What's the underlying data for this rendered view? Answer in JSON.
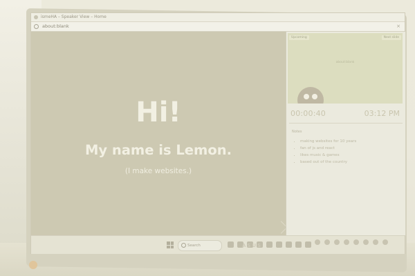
{
  "window": {
    "title": "ismeHA – Speaker View – Home",
    "url": "about:blank",
    "close_glyph": "×"
  },
  "slide": {
    "heading": "Hi!",
    "line": "My name is Lemon.",
    "subline": "(I make websites.)"
  },
  "speaker_view": {
    "preview_label_left": "Upcoming",
    "preview_label_right": "Next slide",
    "preview_center_text": "about:blank",
    "elapsed": "00:00:40",
    "clock": "03:12 PM",
    "notes_title": "Notes",
    "notes": [
      "making websites for 10 years",
      "fan of js and react",
      "likes music & games",
      "based out of the country"
    ]
  },
  "taskbar": {
    "search_placeholder": "Search"
  },
  "laptop": {
    "brand": "ASUS"
  },
  "colors": {
    "slide_bg": "#cdc9b2",
    "slide_text": "#f2f0e3",
    "panel_bg": "#ebeade"
  },
  "icons": [
    "browser-icon",
    "globe-icon",
    "close-icon",
    "avatar-icon",
    "windows-start-icon",
    "search-icon"
  ]
}
